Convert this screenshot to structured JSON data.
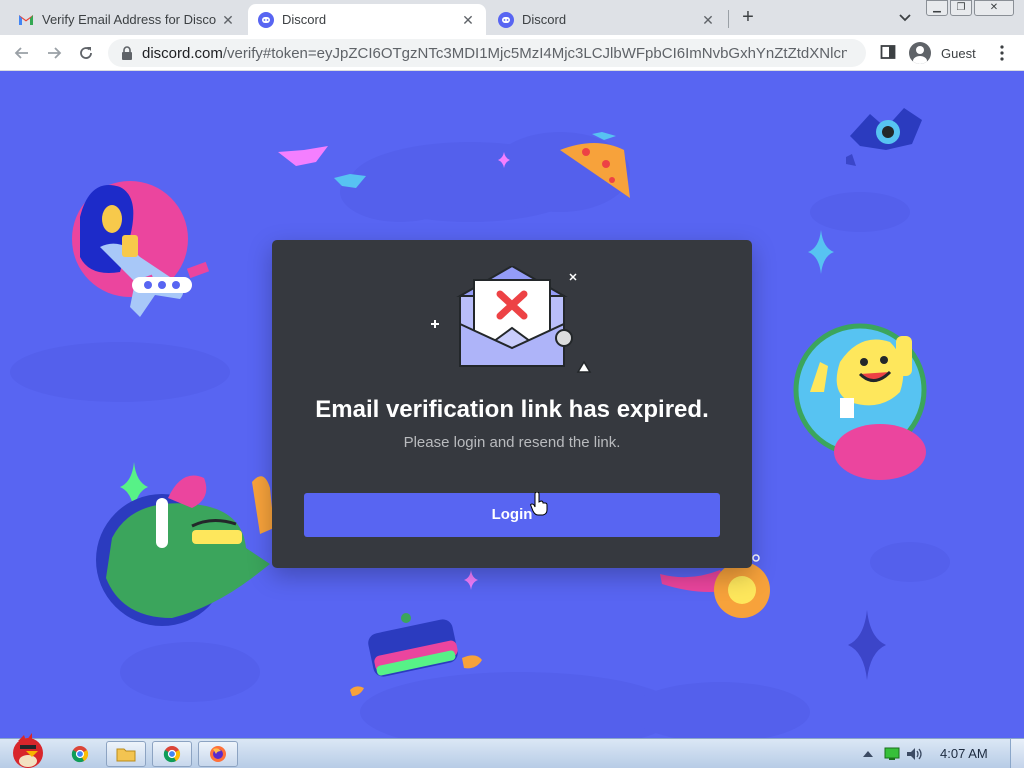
{
  "browser": {
    "tabs": [
      {
        "title": "Verify Email Address for Disco",
        "icon": "gmail-icon",
        "active": false
      },
      {
        "title": "Discord",
        "icon": "discord-icon",
        "active": true
      },
      {
        "title": "Discord",
        "icon": "discord-icon",
        "active": false
      }
    ],
    "address": {
      "host": "discord.com",
      "path": "/verify#token=eyJpZCI6OTgzNTc3MDI1Mjc5MzI4Mjc3LCJlbWFpbCI6ImNvbGxhYnZtZtdXNlcn..."
    },
    "profile_label": "Guest"
  },
  "modal": {
    "heading": "Email verification link has expired.",
    "subtext": "Please login and resend the link.",
    "login_label": "Login"
  },
  "taskbar": {
    "clock": "4:07 AM"
  },
  "colors": {
    "blurple": "#5865f2",
    "modal_bg": "#36393f",
    "error_red": "#ed4245"
  }
}
